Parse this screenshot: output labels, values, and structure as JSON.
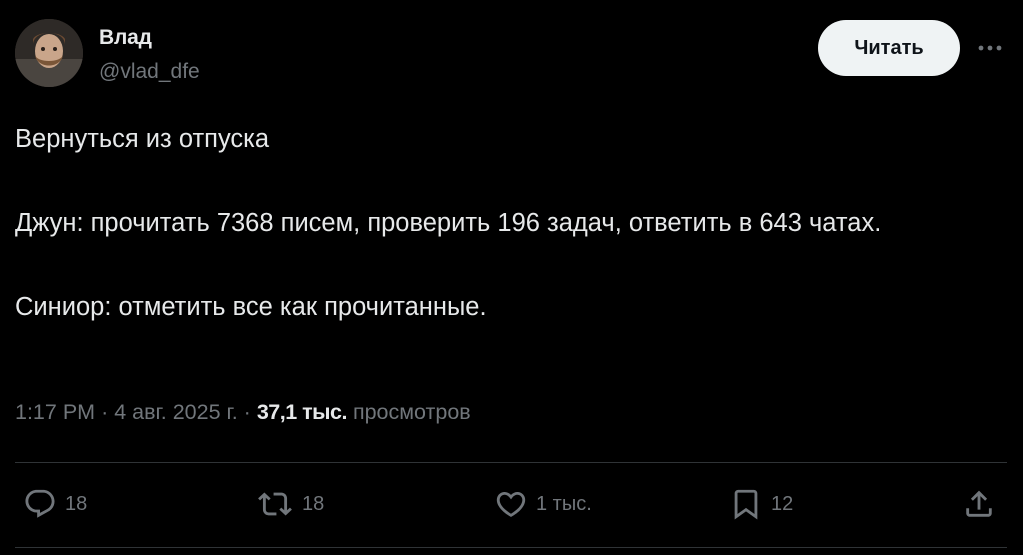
{
  "author": {
    "name": "Влад",
    "handle": "@vlad_dfe",
    "avatar_icon": "user-avatar-photo"
  },
  "header": {
    "follow_label": "Читать",
    "more_icon": "more-horizontal-icon"
  },
  "tweet": {
    "paragraphs": [
      "Вернуться из отпуска",
      "Джун: прочитать 7368 писем, проверить 196 задач, ответить в 643 чатах.",
      "Синиор: отметить все как прочитанные."
    ]
  },
  "meta": {
    "time": "1:17 PM",
    "separator": "·",
    "date": "4 авг. 2025 г.",
    "views_count": "37,1 тыс.",
    "views_label": "просмотров"
  },
  "actions": {
    "reply": {
      "icon": "reply-icon",
      "count": "18"
    },
    "retweet": {
      "icon": "retweet-icon",
      "count": "18"
    },
    "like": {
      "icon": "heart-icon",
      "count": "1 тыс."
    },
    "bookmark": {
      "icon": "bookmark-icon",
      "count": "12"
    },
    "share": {
      "icon": "share-icon"
    }
  },
  "colors": {
    "background": "#000000",
    "text_primary": "#e7e9ea",
    "text_secondary": "#71767b",
    "divider": "#2f3336",
    "button_bg": "#eff3f4",
    "button_text": "#0f1419"
  }
}
